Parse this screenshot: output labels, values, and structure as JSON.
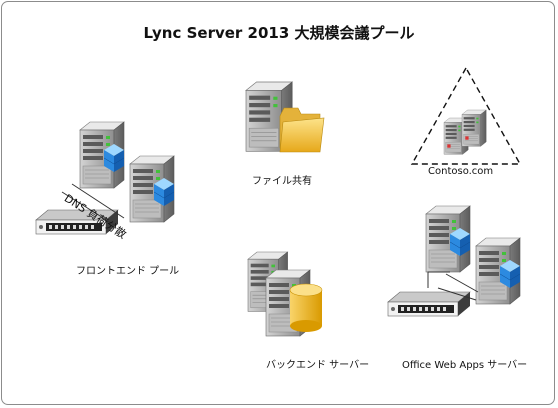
{
  "title": "Lync Server 2013 大規模会議プール",
  "labels": {
    "file_share": "ファイル共有",
    "contoso": "Contoso.com",
    "dns_lb": "DNS 負荷分散",
    "front_end_pool": "フロントエンド プール",
    "back_end_server": "バックエンド サーバー",
    "office_web_apps_server": "Office Web Apps サーバー"
  },
  "colors": {
    "border": "#8c8c8c",
    "server_body": "#a7a7a7",
    "cube_blue": "#2f8fe0",
    "folder_yellow": "#f2c84a",
    "db_yellow": "#f3bd22",
    "green_led": "#42c13a"
  }
}
